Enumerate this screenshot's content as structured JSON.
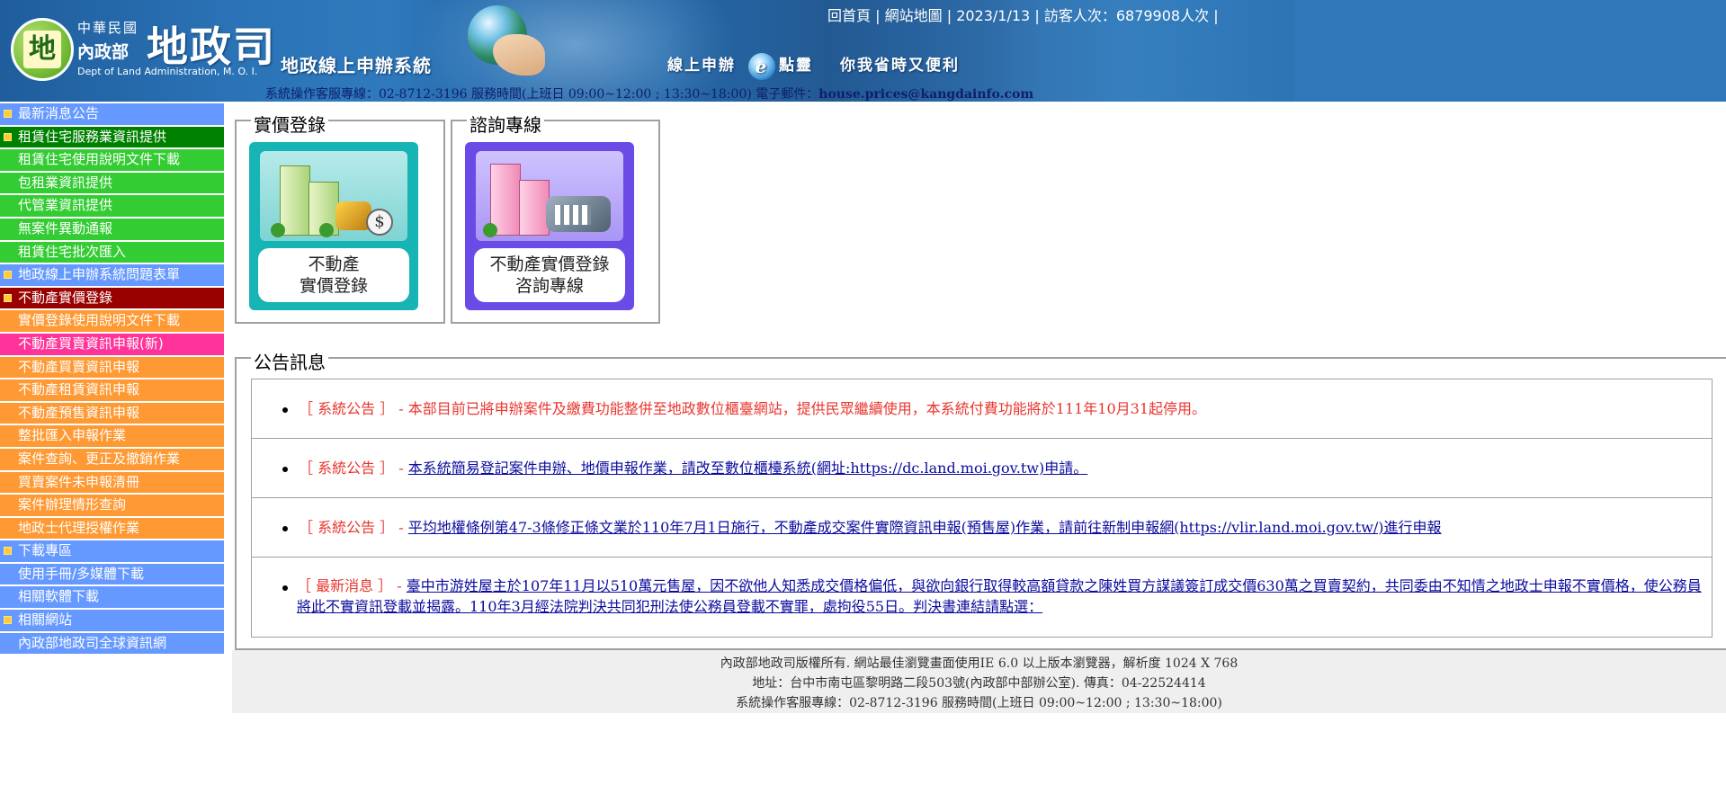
{
  "header": {
    "logo_line1": "中華民國",
    "logo_line2": "內政部",
    "logo_calligraphy": "地政司",
    "logo_en": "Dept of Land Administration, M. O. I.",
    "logo_mark": "地",
    "system_title": "地政線上申辦系統",
    "tagline_part1": "線上申辦",
    "tagline_part2": "點靈",
    "tagline_part3": "你我省時又便利",
    "top_links": {
      "home": "回首頁",
      "sitemap": "網站地圖",
      "date": "2023/1/13",
      "visitor_label": "訪客人次：",
      "visitor_count": "6879908",
      "visitor_unit": "人次"
    },
    "service_line": "系統操作客服專線：02-8712-3196 服務時間(上班日 09:00~12:00 ; 13:30~18:00) 電子郵件：",
    "service_email": "house.prices@kangdainfo.com"
  },
  "sidebar": {
    "items": [
      {
        "label": "最新消息公告",
        "bullet": true,
        "color": "#6699ff"
      },
      {
        "label": "租賃住宅服務業資訊提供",
        "bullet": true,
        "color": "#008000"
      },
      {
        "label": "租賃住宅使用說明文件下載",
        "bullet": false,
        "color": "#33cc33"
      },
      {
        "label": "包租業資訊提供",
        "bullet": false,
        "color": "#33cc33"
      },
      {
        "label": "代管業資訊提供",
        "bullet": false,
        "color": "#33cc33"
      },
      {
        "label": "無案件異動通報",
        "bullet": false,
        "color": "#33cc33"
      },
      {
        "label": "租賃住宅批次匯入",
        "bullet": false,
        "color": "#33cc33"
      },
      {
        "label": "地政線上申辦系統問題表單",
        "bullet": true,
        "color": "#6699ff"
      },
      {
        "label": "不動產實價登錄",
        "bullet": true,
        "color": "#990000"
      },
      {
        "label": "實價登錄使用說明文件下載",
        "bullet": false,
        "color": "#ff9933"
      },
      {
        "label": "不動產買賣資訊申報(新)",
        "bullet": false,
        "color": "#ff3399"
      },
      {
        "label": "不動產買賣資訊申報",
        "bullet": false,
        "color": "#ff9933"
      },
      {
        "label": "不動產租賃資訊申報",
        "bullet": false,
        "color": "#ff9933"
      },
      {
        "label": "不動產預售資訊申報",
        "bullet": false,
        "color": "#ff9933"
      },
      {
        "label": "整批匯入申報作業",
        "bullet": false,
        "color": "#ff9933"
      },
      {
        "label": "案件查詢、更正及撤銷作業",
        "bullet": false,
        "color": "#ff9933"
      },
      {
        "label": "買賣案件未申報清冊",
        "bullet": false,
        "color": "#ff9933"
      },
      {
        "label": "案件辦理情形查詢",
        "bullet": false,
        "color": "#ff9933"
      },
      {
        "label": "地政士代理授權作業",
        "bullet": false,
        "color": "#ff9933"
      },
      {
        "label": "下載專區",
        "bullet": true,
        "color": "#6699ff"
      },
      {
        "label": "使用手冊/多媒體下載",
        "bullet": false,
        "color": "#6699ff"
      },
      {
        "label": "相關軟體下載",
        "bullet": false,
        "color": "#6699ff"
      },
      {
        "label": "相關網站",
        "bullet": true,
        "color": "#6699ff"
      },
      {
        "label": "內政部地政司全球資訊網",
        "bullet": false,
        "color": "#6699ff"
      }
    ]
  },
  "sections": {
    "register_legend": "實價登錄",
    "register_card_line1": "不動產",
    "register_card_line2": "實價登錄",
    "consult_legend": "諮詢專線",
    "consult_card_line1": "不動產實價登錄",
    "consult_card_line2": "咨詢專線",
    "news_legend": "公告訊息"
  },
  "news": [
    {
      "tag": "［ 系統公告 ］ - ",
      "text": "本部目前已將申辦案件及繳費功能整併至地政數位櫃臺網站，提供民眾繼續使用，本系統付費功能將於111年10月31起停用。",
      "link": false
    },
    {
      "tag": "［ 系統公告 ］ - ",
      "text": "本系統簡易登記案件申辦、地價申報作業，請改至數位櫃檯系統(網址:https://dc.land.moi.gov.tw)申請。",
      "link": true
    },
    {
      "tag": "［ 系統公告 ］ - ",
      "text": "平均地權條例第47-3條修正條文業於110年7月1日施行，不動產成交案件實際資訊申報(預售屋)作業，請前往新制申報網(https://vlir.land.moi.gov.tw/)進行申報",
      "link": true
    },
    {
      "tag": "［ 最新消息 ］ - ",
      "text": "臺中市游姓屋主於107年11月以510萬元售屋，因不欲他人知悉成交價格偏低，與欲向銀行取得較高額貸款之陳姓買方謀議簽訂成交價630萬之買賣契約，共同委由不知情之地政士申報不實價格，使公務員將此不實資訊登載並揭露。110年3月經法院判決共同犯刑法使公務員登載不實罪，處拘役55日。判決書連結請點選：",
      "link": true
    }
  ],
  "footer": {
    "line1": "內政部地政司版權所有. 網站最佳瀏覽畫面使用IE 6.0 以上版本瀏覽器，解析度 1024 X 768",
    "line2": "地址：台中市南屯區黎明路二段503號(內政部中部辦公室). 傳真：04-22524414",
    "line3": "系統操作客服專線：02-8712-3196 服務時間(上班日 09:00~12:00 ; 13:30~18:00)"
  }
}
